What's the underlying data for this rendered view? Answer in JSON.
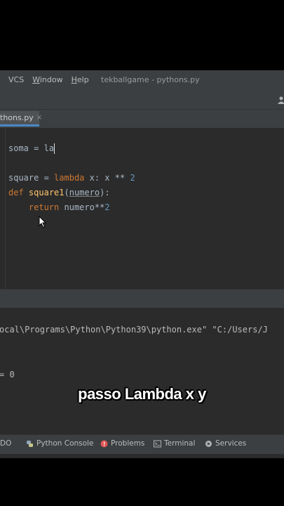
{
  "menubar": {
    "items": [
      "VCS",
      "Window",
      "Help"
    ],
    "window_title": "tekballgame - pythons.py"
  },
  "tab": {
    "label": "thons.py",
    "close_glyph": "×"
  },
  "editor": {
    "line1": {
      "var": "soma",
      "op": " = ",
      "typed": "la"
    },
    "line2": {
      "var": "square",
      "op": " = ",
      "kw": "lambda",
      "rest": " x: x ** ",
      "num": "2"
    },
    "line3": {
      "kw": "def",
      "fn": "square1",
      "open": "(",
      "param": "numero",
      "close": "):"
    },
    "line4": {
      "indent": "    ",
      "kw": "return",
      "rest": " numero**",
      "num": "2"
    }
  },
  "console": {
    "command": "ocal\\Programs\\Python\\Python39\\python.exe\" \"C:/Users/J",
    "output": "= 0"
  },
  "subtitle": "passo Lambda x y",
  "toolbar": {
    "todo": "DO",
    "python_console": "Python Console",
    "problems": "Problems",
    "terminal": "Terminal",
    "services": "Services"
  },
  "colors": {
    "background": "#2b2b2b",
    "panel": "#3c3f41",
    "keyword": "#cc7832",
    "function": "#ffc66d",
    "number": "#6897bb",
    "problems_icon": "#e05555"
  }
}
